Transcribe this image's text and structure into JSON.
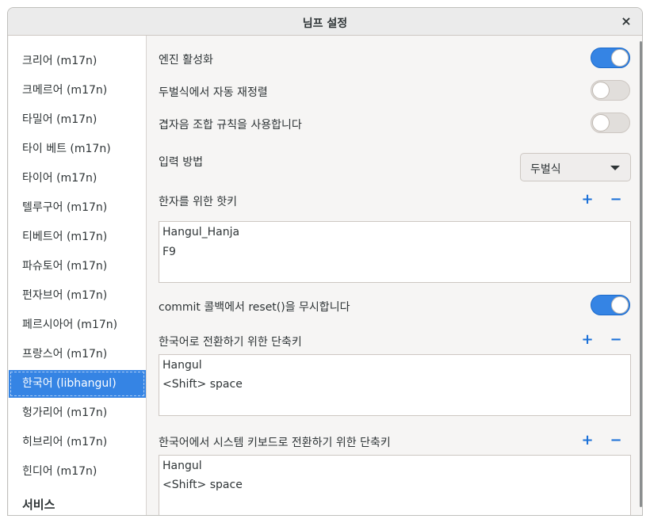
{
  "window": {
    "title": "님프 설정"
  },
  "sidebar": {
    "items": [
      {
        "label": "크리어 (m17n)",
        "selected": false
      },
      {
        "label": "크메르어 (m17n)",
        "selected": false
      },
      {
        "label": "타밀어 (m17n)",
        "selected": false
      },
      {
        "label": "타이 베트 (m17n)",
        "selected": false
      },
      {
        "label": "타이어 (m17n)",
        "selected": false
      },
      {
        "label": "텔루구어 (m17n)",
        "selected": false
      },
      {
        "label": "티베트어 (m17n)",
        "selected": false
      },
      {
        "label": "파슈토어 (m17n)",
        "selected": false
      },
      {
        "label": "펀자브어 (m17n)",
        "selected": false
      },
      {
        "label": "페르시아어 (m17n)",
        "selected": false
      },
      {
        "label": "프랑스어 (m17n)",
        "selected": false
      },
      {
        "label": "한국어 (libhangul)",
        "selected": true
      },
      {
        "label": "헝가리어 (m17n)",
        "selected": false
      },
      {
        "label": "히브리어 (m17n)",
        "selected": false
      },
      {
        "label": "힌디어 (m17n)",
        "selected": false
      }
    ],
    "section_heading": "서비스"
  },
  "settings": {
    "enable_engine": {
      "label": "엔진 활성화",
      "value": true
    },
    "dubeolsik_reorder": {
      "label": "두벌식에서 자동 재정렬",
      "value": false
    },
    "jaso_rules": {
      "label": "겹자음 조합 규칙을 사용합니다",
      "value": false
    },
    "input_method": {
      "label": "입력 방법",
      "selected": "두벌식"
    },
    "hanja_hotkeys": {
      "label": "한자를 위한 핫키",
      "items": [
        "Hangul_Hanja",
        "F9"
      ]
    },
    "ignore_reset": {
      "label": "commit 콜백에서 reset()을 무시합니다",
      "value": true
    },
    "switch_to_korean": {
      "label": "한국어로 전환하기 위한 단축키",
      "items": [
        "Hangul",
        "<Shift> space"
      ]
    },
    "switch_to_system": {
      "label": "한국어에서 시스템 키보드로 전환하기 위한 단축키",
      "items": [
        "Hangul",
        "<Shift> space"
      ]
    }
  },
  "buttons": {
    "add": "+",
    "remove": "−",
    "close": "×"
  },
  "colors": {
    "accent": "#3584e4",
    "icon_blue": "#1c71d8"
  }
}
